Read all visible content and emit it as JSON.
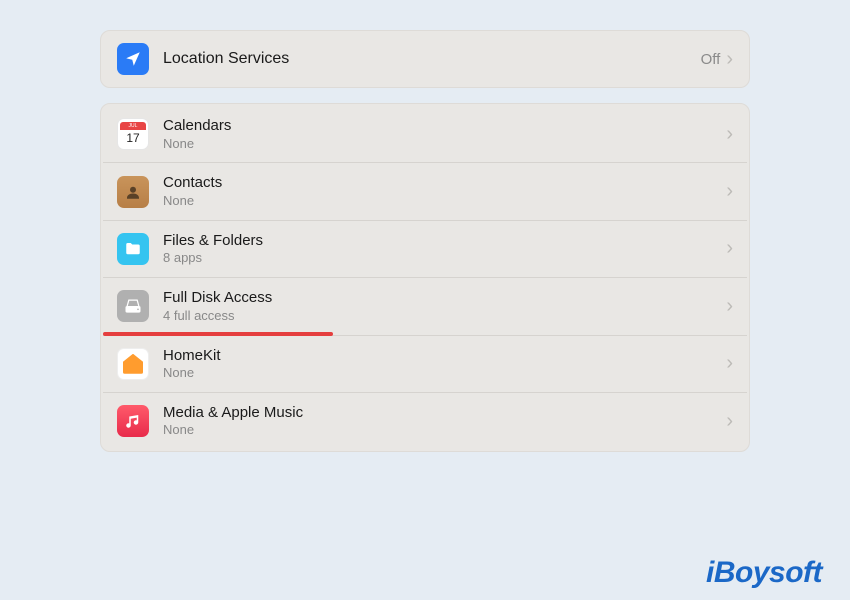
{
  "location": {
    "label": "Location Services",
    "value": "Off"
  },
  "rows": [
    {
      "label": "Calendars",
      "sub": "None",
      "icon": "calendar"
    },
    {
      "label": "Contacts",
      "sub": "None",
      "icon": "contacts"
    },
    {
      "label": "Files & Folders",
      "sub": "8 apps",
      "icon": "files"
    },
    {
      "label": "Full Disk Access",
      "sub": "4 full access",
      "icon": "disk",
      "underline": true
    },
    {
      "label": "HomeKit",
      "sub": "None",
      "icon": "homekit"
    },
    {
      "label": "Media & Apple Music",
      "sub": "None",
      "icon": "media"
    }
  ],
  "calendar_icon": {
    "month": "JUL",
    "day": "17"
  },
  "watermark": "iBoysoft"
}
